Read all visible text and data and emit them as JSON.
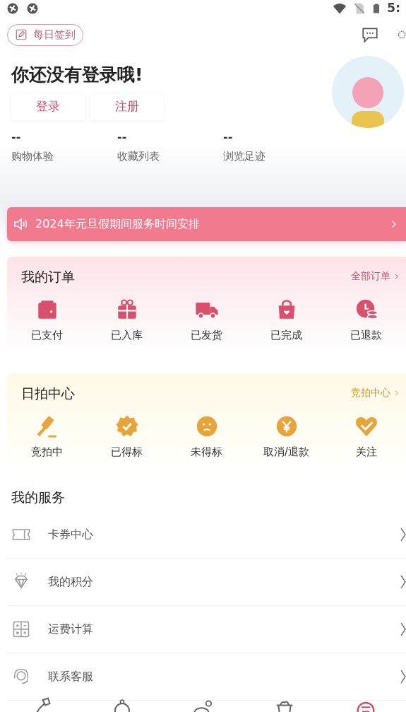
{
  "status_bar": {
    "time": "5:"
  },
  "checkin": {
    "label": "每日签到"
  },
  "greeting": "你还没有登录哦!",
  "auth_buttons": [
    "登录",
    "注册"
  ],
  "stats": [
    {
      "value": "--",
      "label": "购物体验"
    },
    {
      "value": "--",
      "label": "收藏列表"
    },
    {
      "value": "--",
      "label": "浏览足迹"
    }
  ],
  "notice": {
    "text": "2024年元旦假期间服务时间安排"
  },
  "orders": {
    "title": "我的订单",
    "link": "全部订单",
    "items": [
      "已支付",
      "已入库",
      "已发货",
      "已完成",
      "已退款"
    ]
  },
  "auction": {
    "title": "日拍中心",
    "link": "竞拍中心",
    "items": [
      "竞拍中",
      "已得标",
      "未得标",
      "取消/退款",
      "关注"
    ]
  },
  "services": {
    "title": "我的服务",
    "items": [
      "卡券中心",
      "我的积分",
      "运费计算",
      "联系客服"
    ]
  },
  "bottom_nav": [
    {
      "selected": false
    },
    {
      "selected": false
    },
    {
      "selected": false
    },
    {
      "selected": false
    },
    {
      "selected": true
    }
  ]
}
